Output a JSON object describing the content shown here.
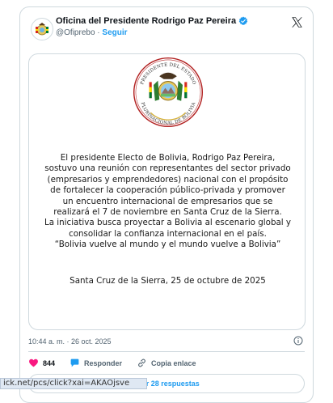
{
  "tweet": {
    "author_name": "Oficina del Presidente Rodrigo Paz Pereira",
    "handle": "@Ofiprebo",
    "separator": "·",
    "follow_label": "Seguir",
    "timestamp": "10:44 a. m. · 26 oct. 2025",
    "likes_count": "844",
    "reply_label": "Responder",
    "copy_link_label": "Copia enlace",
    "read_replies_label": "Leer 28 respuestas"
  },
  "media": {
    "seal_text": "PRESIDENTE DEL ESTADO PLURINACIONAL DE BOLIVIA",
    "statement_lines": [
      "El presidente Electo de Bolivia, Rodrigo Paz Pereira,",
      "sostuvo una reunión con representantes del sector privado",
      "(empresarios y emprendedores) nacional con el propósito",
      "de fortalecer la cooperación público-privada y promover",
      "un encuentro internacional de empresarios que se",
      "realizará el 7 de noviembre en Santa Cruz de la Sierra.",
      "La iniciativa busca proyectar a Bolivia al escenario global y",
      "consolidar la confianza internacional en el país.",
      "“Bolivia vuelve al mundo y el mundo vuelve a Bolivia”"
    ],
    "place_date": "Santa Cruz de la Sierra, 25 de octubre de 2025"
  },
  "status_bar": {
    "url": "ick.net/pcs/click?xai=AKAOjsve"
  },
  "colors": {
    "accent": "#1d9bf0",
    "like": "#f91880",
    "border": "#cfd9de",
    "muted": "#536471"
  },
  "icons": [
    "bolivia-coat-of-arms-icon",
    "verified-badge-icon",
    "x-logo-icon",
    "info-icon",
    "heart-icon",
    "reply-bubble-icon",
    "link-icon"
  ]
}
